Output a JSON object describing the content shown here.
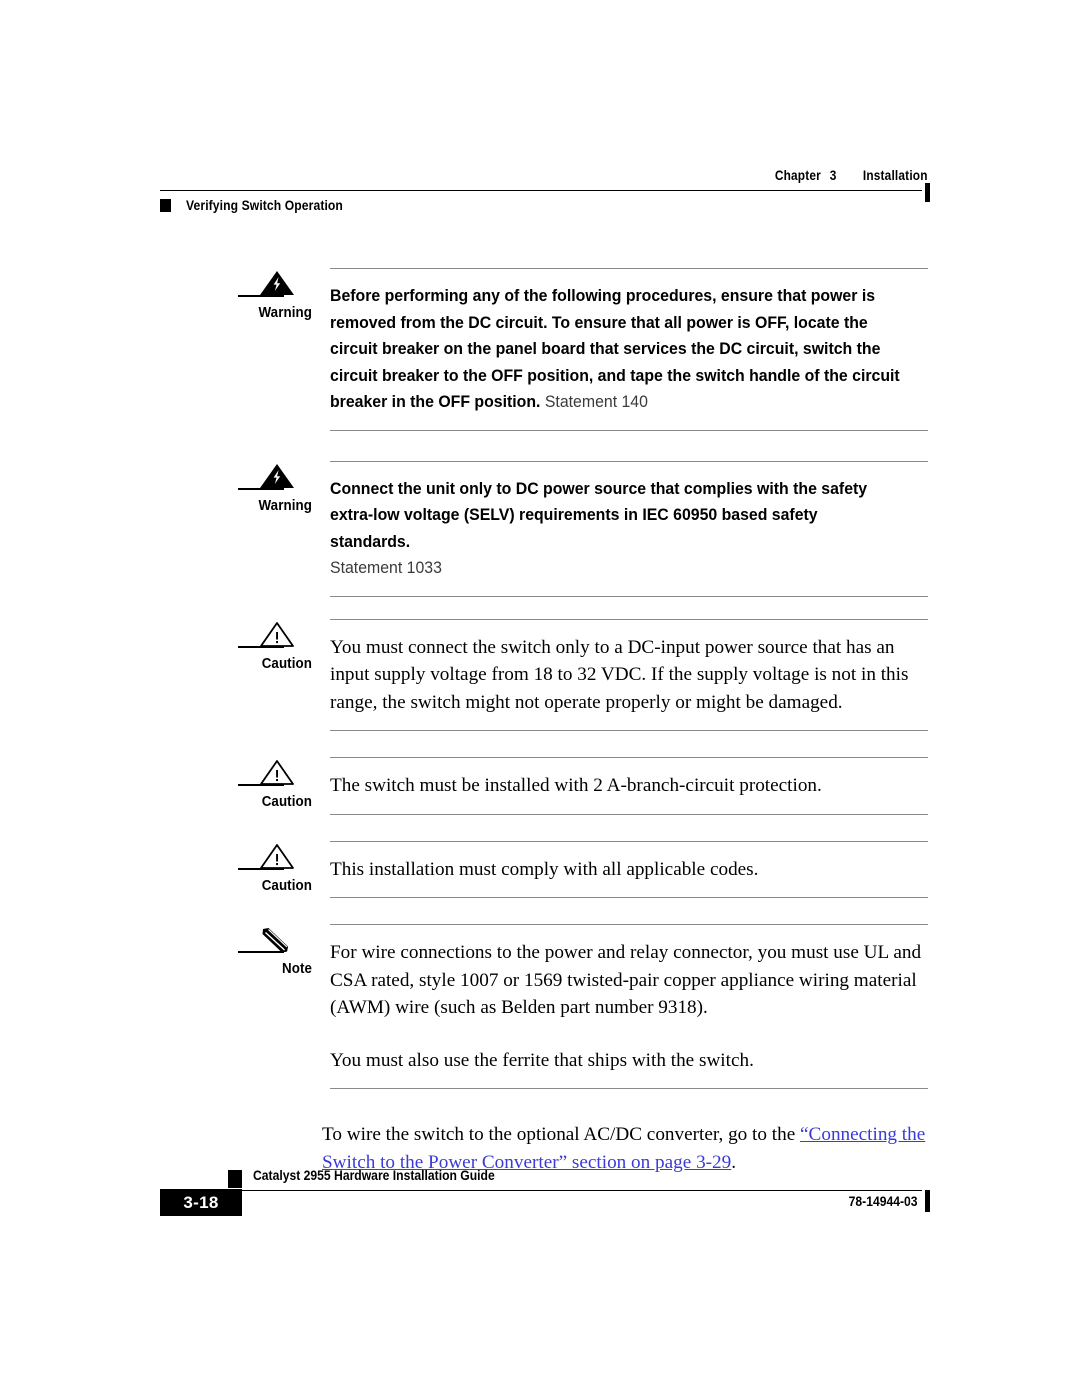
{
  "header": {
    "chapter_label": "Chapter",
    "chapter_number": "3",
    "chapter_title": "Installation",
    "section_title": "Verifying Switch Operation"
  },
  "admonitions": [
    {
      "type": "warning",
      "icon": "warning-lightning-triangle-icon",
      "label": "Warning",
      "bold_text": "Before performing any of the following procedures, ensure that power is removed from the DC circuit. To ensure that all power is OFF, locate the circuit breaker on the panel board that services the DC circuit, switch the circuit breaker to the OFF position, and tape the switch handle of the circuit breaker in the OFF position.",
      "statement": "Statement 140"
    },
    {
      "type": "warning",
      "icon": "warning-lightning-triangle-icon",
      "label": "Warning",
      "bold_text": "Connect the unit only to DC power source that complies with the safety extra-low voltage (SELV) requirements in IEC 60950 based safety standards.",
      "statement": "Statement 1033"
    },
    {
      "type": "caution",
      "icon": "caution-exclamation-triangle-icon",
      "label": "Caution",
      "paragraphs": [
        "You must connect the switch only to a DC-input power source that has an input supply voltage from 18 to 32 VDC. If the supply voltage is not in this range, the switch might not operate properly or might be damaged."
      ]
    },
    {
      "type": "caution",
      "icon": "caution-exclamation-triangle-icon",
      "label": "Caution",
      "paragraphs": [
        "The switch must be installed with 2 A-branch-circuit protection."
      ]
    },
    {
      "type": "caution",
      "icon": "caution-exclamation-triangle-icon",
      "label": "Caution",
      "paragraphs": [
        "This installation must comply with all applicable codes."
      ]
    },
    {
      "type": "note",
      "icon": "note-pencil-icon",
      "label": "Note",
      "paragraphs": [
        "For wire connections to the power and relay connector, you must use UL and CSA rated, style 1007 or 1569 twisted-pair copper appliance wiring material (AWM) wire (such as Belden part number 9318).",
        "You must also use the ferrite that ships with the switch."
      ]
    }
  ],
  "body": {
    "xref_paragraph_lead": "To wire the switch to the optional AC/DC converter, go to the ",
    "xref_link_text": "“Connecting the Switch to the Power Converter” section on page 3-29",
    "xref_paragraph_tail": ".",
    "xref_color": "#3a3ad8"
  },
  "footer": {
    "guide_title": "Catalyst 2955 Hardware Installation Guide",
    "page_number": "3-18",
    "document_number": "78-14944-03"
  }
}
